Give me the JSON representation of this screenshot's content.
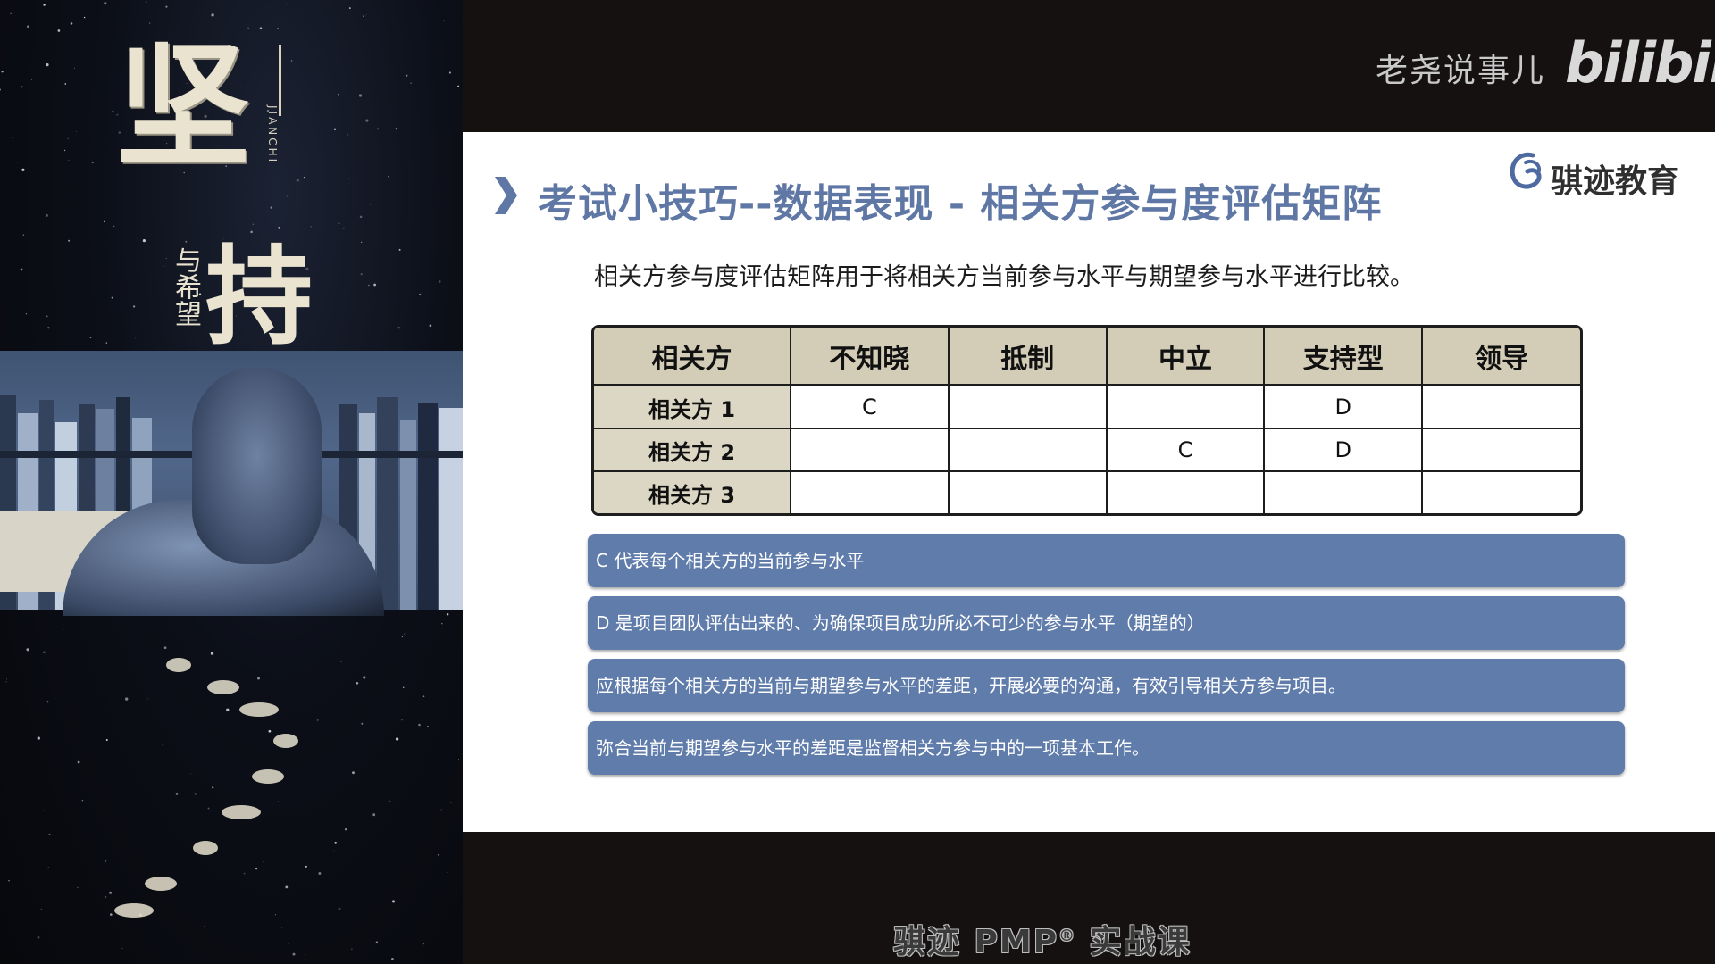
{
  "colors": {
    "slide_title": "#5f77a4",
    "note_bar": "#5f7cab",
    "table_header_bg": "#d3cdb8",
    "table_rowhead_bg": "#dcd7c4"
  },
  "poster": {
    "title_char1": "坚",
    "title_char2": "持",
    "romanization": "JIANCHI",
    "subtitle": "与希望"
  },
  "brand": {
    "channel_name": "老尧说事儿",
    "platform_logo": "bilibili"
  },
  "slide": {
    "title": "考试小技巧--数据表现 - 相关方参与度评估矩阵",
    "logo_text": "骐迹教育",
    "logo_icon": "swirl-logo-icon",
    "intro": "相关方参与度评估矩阵用于将相关方当前参与水平与期望参与水平进行比较。",
    "matrix": {
      "headers": [
        "相关方",
        "不知晓",
        "抵制",
        "中立",
        "支持型",
        "领导"
      ],
      "rows": [
        {
          "label": "相关方 1",
          "cells": [
            "C",
            "",
            "",
            "D",
            ""
          ]
        },
        {
          "label": "相关方 2",
          "cells": [
            "",
            "",
            "C",
            "D",
            ""
          ]
        },
        {
          "label": "相关方 3",
          "cells": [
            "",
            "",
            "",
            "",
            ""
          ]
        }
      ]
    },
    "notes": [
      "C 代表每个相关方的当前参与水平",
      "D 是项目团队评估出来的、为确保项目成功所必不可少的参与水平（期望的）",
      "应根据每个相关方的当前与期望参与水平的差距，开展必要的沟通，有效引导相关方参与项目。",
      "弥合当前与期望参与水平的差距是监督相关方参与中的一项基本工作。"
    ]
  },
  "footer": {
    "prefix": "骐迹 PMP",
    "reg": "®",
    "suffix": " 实战课"
  }
}
